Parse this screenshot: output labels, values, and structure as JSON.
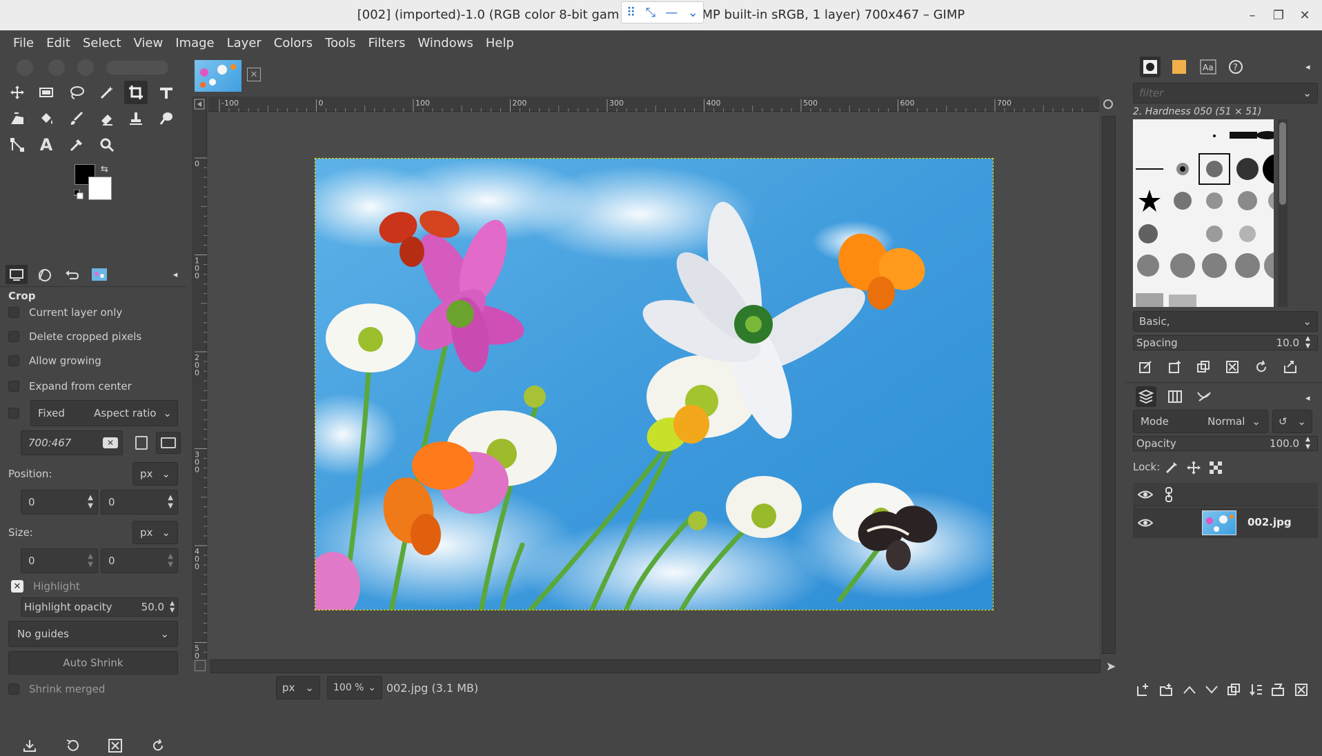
{
  "window": {
    "title": "[002] (imported)-1.0 (RGB color 8-bit gamma integer, GIMP built-in sRGB, 1 layer) 700x467 – GIMP",
    "title_left": "[002] (imported)-1.0 (RGB color 8-bit gam",
    "title_right": "MP built-in sRGB, 1 layer) 700x467 – GIMP",
    "minimize": "–",
    "maximize": "❐",
    "close": "✕"
  },
  "menu": [
    "File",
    "Edit",
    "Select",
    "View",
    "Image",
    "Layer",
    "Colors",
    "Tools",
    "Filters",
    "Windows",
    "Help"
  ],
  "tool_options": {
    "title": "Crop",
    "current_layer_only": "Current layer only",
    "delete_cropped": "Delete cropped pixels",
    "allow_growing": "Allow growing",
    "expand_from_center": "Expand from center",
    "fixed": "Fixed",
    "aspect_ratio": "Aspect ratio",
    "ratio_value": "700:467",
    "position_label": "Position:",
    "position_unit": "px",
    "pos_x": "0",
    "pos_y": "0",
    "size_label": "Size:",
    "size_unit": "px",
    "size_w": "0",
    "size_h": "0",
    "highlight": "Highlight",
    "highlight_opacity_label": "Highlight opacity",
    "highlight_opacity_value": "50.0",
    "guides": "No guides",
    "auto_shrink": "Auto Shrink",
    "shrink_merged": "Shrink merged"
  },
  "rulers": {
    "h_ticks": [
      "-100",
      "0",
      "100",
      "200",
      "300",
      "400",
      "500",
      "600",
      "700"
    ],
    "v_ticks": [
      "0",
      "100",
      "200",
      "300",
      "400",
      "500"
    ]
  },
  "status": {
    "unit": "px",
    "zoom": "100 %",
    "file": "002.jpg (3.1 MB)"
  },
  "brushes": {
    "filter_placeholder": "filter",
    "current": "2. Hardness 050 (51 × 51)",
    "tag": "Basic,",
    "spacing_label": "Spacing",
    "spacing_value": "10.0"
  },
  "layers": {
    "mode_label": "Mode",
    "mode_value": "Normal",
    "opacity_label": "Opacity",
    "opacity_value": "100.0",
    "lock_label": "Lock:",
    "layer_name": "002.jpg"
  }
}
